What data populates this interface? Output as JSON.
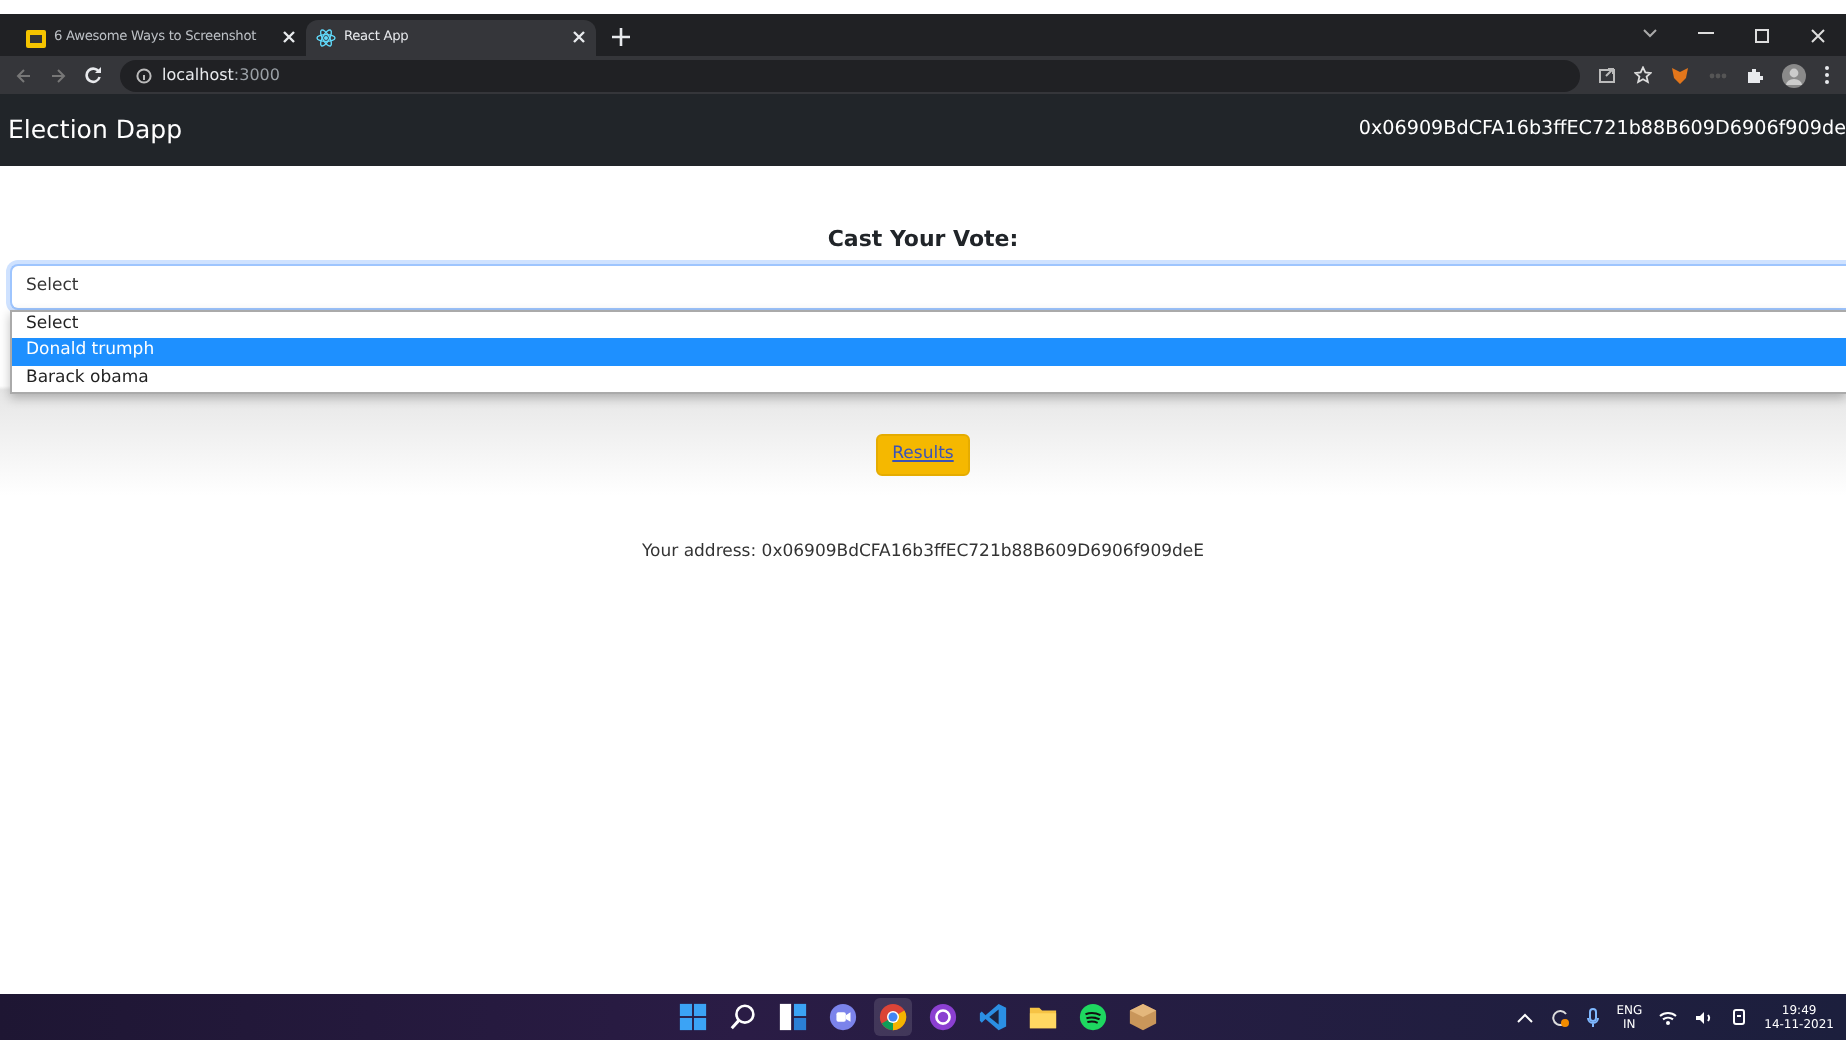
{
  "browser": {
    "tabs": [
      {
        "title": "6 Awesome Ways to Screenshot",
        "kind": "article",
        "selected": false
      },
      {
        "title": "React App",
        "kind": "react",
        "selected": true
      }
    ],
    "url_host": "localhost",
    "url_port": ":3000"
  },
  "navbar": {
    "brand": "Election Dapp",
    "account": "0x06909BdCFA16b3ffEC721b88B609D6906f909de"
  },
  "vote": {
    "heading": "Cast Your Vote:",
    "select_value": "Select",
    "options": [
      {
        "label": "Select",
        "selected": false
      },
      {
        "label": "Donald trumph",
        "selected": true
      },
      {
        "label": "Barack obama",
        "selected": false
      }
    ],
    "button": "Results",
    "address_line": "Your address: 0x06909BdCFA16b3ffEC721b88B609D6906f909deE"
  },
  "taskbar": {
    "apps": [
      {
        "kind": "start",
        "active": false
      },
      {
        "kind": "search",
        "active": false
      },
      {
        "kind": "widgets",
        "active": false
      },
      {
        "kind": "chat",
        "active": false
      },
      {
        "kind": "chrome",
        "active": true
      },
      {
        "kind": "github",
        "active": false
      },
      {
        "kind": "vscode",
        "active": false
      },
      {
        "kind": "folder",
        "active": false
      },
      {
        "kind": "spotify",
        "active": false
      },
      {
        "kind": "box",
        "active": false
      }
    ],
    "lang": "ENG",
    "region": "IN",
    "time": "19:49",
    "date": "14-11-2021"
  }
}
